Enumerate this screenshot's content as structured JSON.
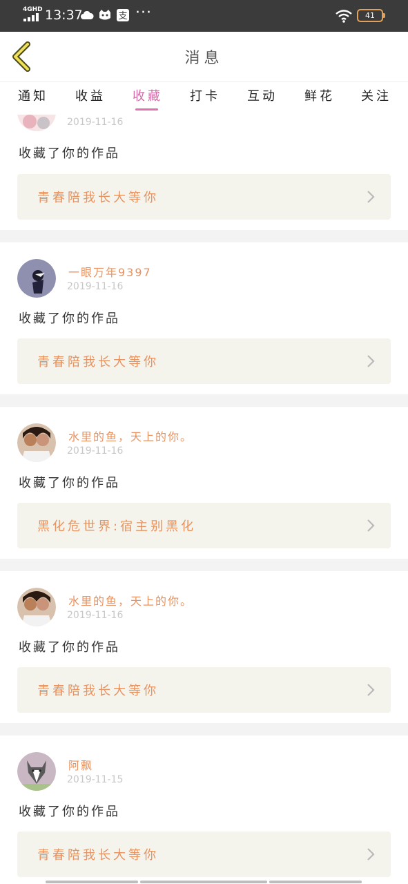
{
  "status_bar": {
    "network": "4GHD",
    "time": "13:37",
    "battery": "41",
    "more": "···"
  },
  "header": {
    "title": "消息",
    "back_icon": "chevron-left-icon"
  },
  "tabs": [
    {
      "label": "通知",
      "active": false
    },
    {
      "label": "收益",
      "active": false
    },
    {
      "label": "收藏",
      "active": true
    },
    {
      "label": "打卡",
      "active": false
    },
    {
      "label": "互动",
      "active": false
    },
    {
      "label": "鲜花",
      "active": false
    },
    {
      "label": "关注",
      "active": false
    }
  ],
  "messages": [
    {
      "user": "",
      "date": "2019-11-16",
      "action": "收藏了你的作品",
      "work": "青春陪我长大等你"
    },
    {
      "user": "一眼万年9397",
      "date": "2019-11-16",
      "action": "收藏了你的作品",
      "work": "青春陪我长大等你"
    },
    {
      "user": "水里的鱼，天上的你。",
      "date": "2019-11-16",
      "action": "收藏了你的作品",
      "work": "黑化危世界:宿主别黑化"
    },
    {
      "user": "水里的鱼，天上的你。",
      "date": "2019-11-16",
      "action": "收藏了你的作品",
      "work": "青春陪我长大等你"
    },
    {
      "user": "阿飘",
      "date": "2019-11-15",
      "action": "收藏了你的作品",
      "work": "青春陪我长大等你"
    }
  ],
  "colors": {
    "accent_tab": "#d56aa6",
    "username": "#e8925f",
    "work_bg": "#f4f4ec"
  }
}
